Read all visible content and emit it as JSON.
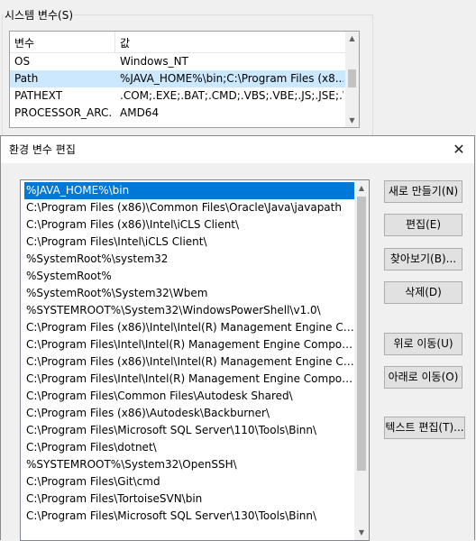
{
  "background": {
    "group_title": "시스템 변수(S)",
    "columns": [
      "변수",
      "값"
    ],
    "rows": [
      {
        "name": "OS",
        "value": "Windows_NT"
      },
      {
        "name": "Path",
        "value": "%JAVA_HOME%\\bin;C:\\Program Files (x8..."
      },
      {
        "name": "PATHEXT",
        "value": ".COM;.EXE;.BAT;.CMD;.VBS;.VBE;.JS;.JSE;.W..."
      },
      {
        "name": "PROCESSOR_ARC...",
        "value": "AMD64"
      }
    ]
  },
  "dialog": {
    "title": "환경 변수 편집",
    "close_glyph": "✕",
    "paths": [
      "%JAVA_HOME%\\bin",
      "C:\\Program Files (x86)\\Common Files\\Oracle\\Java\\javapath",
      "C:\\Program Files (x86)\\Intel\\iCLS Client\\",
      "C:\\Program Files\\Intel\\iCLS Client\\",
      "%SystemRoot%\\system32",
      "%SystemRoot%",
      "%SystemRoot%\\System32\\Wbem",
      "%SYSTEMROOT%\\System32\\WindowsPowerShell\\v1.0\\",
      "C:\\Program Files (x86)\\Intel\\Intel(R) Management Engine Com...",
      "C:\\Program Files\\Intel\\Intel(R) Management Engine Componen...",
      "C:\\Program Files (x86)\\Intel\\Intel(R) Management Engine Com...",
      "C:\\Program Files\\Intel\\Intel(R) Management Engine Componen...",
      "C:\\Program Files\\Common Files\\Autodesk Shared\\",
      "C:\\Program Files (x86)\\Autodesk\\Backburner\\",
      "C:\\Program Files\\Microsoft SQL Server\\110\\Tools\\Binn\\",
      "C:\\Program Files\\dotnet\\",
      "%SYSTEMROOT%\\System32\\OpenSSH\\",
      "C:\\Program Files\\Git\\cmd",
      "C:\\Program Files\\TortoiseSVN\\bin",
      "C:\\Program Files\\Microsoft SQL Server\\130\\Tools\\Binn\\"
    ],
    "buttons": {
      "new": "새로 만들기(N)",
      "edit": "편집(E)",
      "browse": "찾아보기(B)...",
      "delete": "삭제(D)",
      "move_up": "위로 이동(U)",
      "move_down": "아래로 이동(O)",
      "edit_text": "텍스트 편집(T)..."
    }
  },
  "colors": {
    "selection": "#0078d7",
    "row_highlight": "#cce8ff"
  }
}
